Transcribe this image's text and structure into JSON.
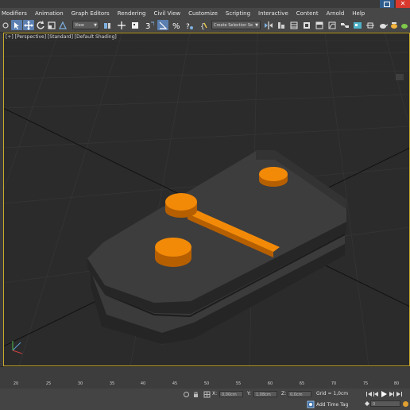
{
  "menu": {
    "items": [
      "Modifiers",
      "Animation",
      "Graph Editors",
      "Rendering",
      "Civil View",
      "Customize",
      "Scripting",
      "Interactive",
      "Content",
      "Arnold",
      "Help"
    ]
  },
  "toolbar": {
    "view_dropdown": "View",
    "selection_set_dropdown": "Create Selection Se"
  },
  "viewport": {
    "label": "[+] [Perspective] [Standard] [Default Shading]",
    "accent_color": "#c8aa2e",
    "object_color": "#3a3a3a",
    "pip_color": "#f28a08"
  },
  "timeline": {
    "ticks": [
      "20",
      "25",
      "30",
      "35",
      "40",
      "45",
      "50",
      "55",
      "60",
      "65",
      "70",
      "75",
      "80"
    ]
  },
  "status": {
    "x_label": "X:",
    "x_value": "0,00cm",
    "y_label": "Y:",
    "y_value": "1,08cm",
    "z_label": "Z:",
    "z_value": "0,0cm",
    "grid": "Grid = 1,0cm",
    "add_time_tag": "Add Time Tag",
    "frame_value": "0"
  }
}
